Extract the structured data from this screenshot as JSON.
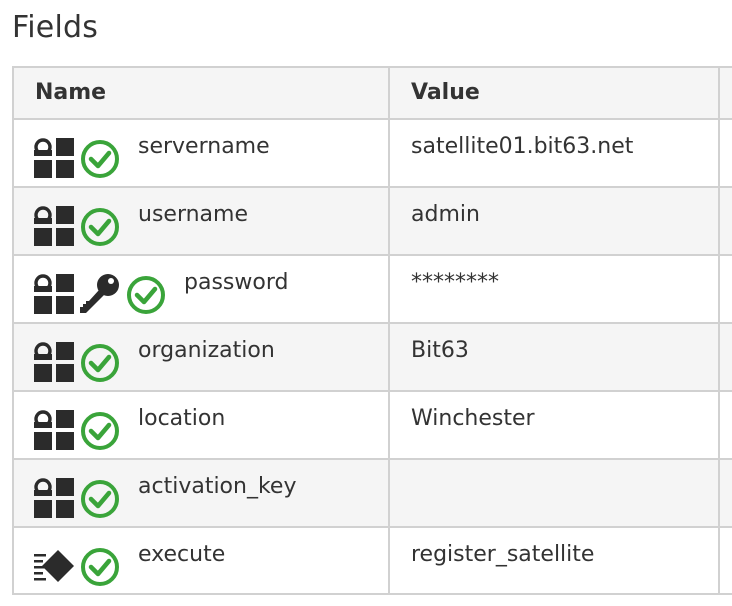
{
  "section_title": "Fields",
  "columns": {
    "name": "Name",
    "value": "Value"
  },
  "colors": {
    "check_green": "#3aa43a",
    "icon_dark": "#2b2b2b",
    "border": "#d1d1d1",
    "shade": "#f5f5f5"
  },
  "rows": [
    {
      "name": "servername",
      "value": "satellite01.bit63.net",
      "icons": [
        "parameter-icon",
        "check-circle-icon"
      ]
    },
    {
      "name": "username",
      "value": "admin",
      "icons": [
        "parameter-icon",
        "check-circle-icon"
      ]
    },
    {
      "name": "password",
      "value": "********",
      "icons": [
        "parameter-icon",
        "key-icon",
        "check-circle-icon"
      ]
    },
    {
      "name": "organization",
      "value": "Bit63",
      "icons": [
        "parameter-icon",
        "check-circle-icon"
      ]
    },
    {
      "name": "location",
      "value": "Winchester",
      "icons": [
        "parameter-icon",
        "check-circle-icon"
      ]
    },
    {
      "name": "activation_key",
      "value": "",
      "icons": [
        "parameter-icon",
        "check-circle-icon"
      ]
    },
    {
      "name": "execute",
      "value": "register_satellite",
      "icons": [
        "execute-icon",
        "check-circle-icon"
      ]
    }
  ]
}
